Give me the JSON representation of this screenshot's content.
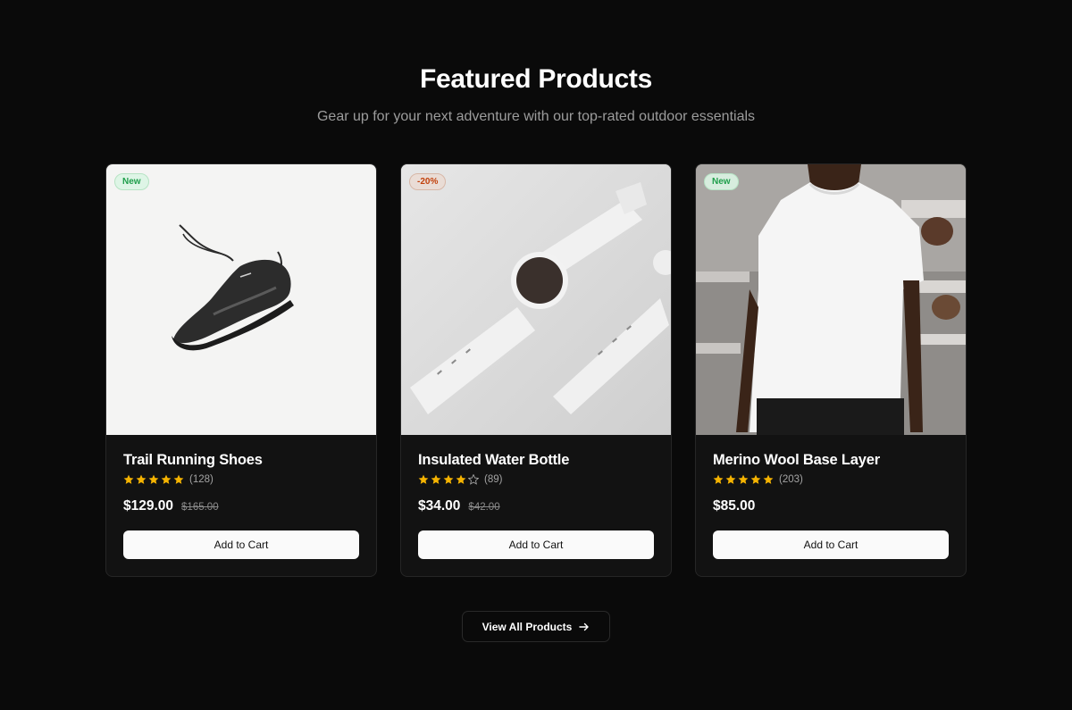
{
  "section": {
    "title": "Featured Products",
    "subtitle": "Gear up for your next adventure with our top-rated outdoor essentials"
  },
  "products": [
    {
      "badge": "New",
      "name": "Trail Running Shoes",
      "rating": 5,
      "reviews": "(128)",
      "price": "$129.00",
      "old_price": "$165.00",
      "image_icon": "running-shoe-photo"
    },
    {
      "badge": "-20%",
      "name": "Insulated Water Bottle",
      "rating": 4,
      "reviews": "(89)",
      "price": "$34.00",
      "old_price": "$42.00",
      "image_icon": "smartwatch-photo"
    },
    {
      "badge": "New",
      "name": "Merino Wool Base Layer",
      "rating": 5,
      "reviews": "(203)",
      "price": "$85.00",
      "old_price": "",
      "image_icon": "white-tshirt-photo"
    }
  ],
  "actions": {
    "add_to_cart_label": "Add to Cart",
    "view_all_label": "View All Products"
  },
  "colors": {
    "background": "#0a0a0a",
    "card": "#121212",
    "star": "#f5b301",
    "new_badge": "#1e9e4a",
    "sale_badge": "#c2410c"
  }
}
